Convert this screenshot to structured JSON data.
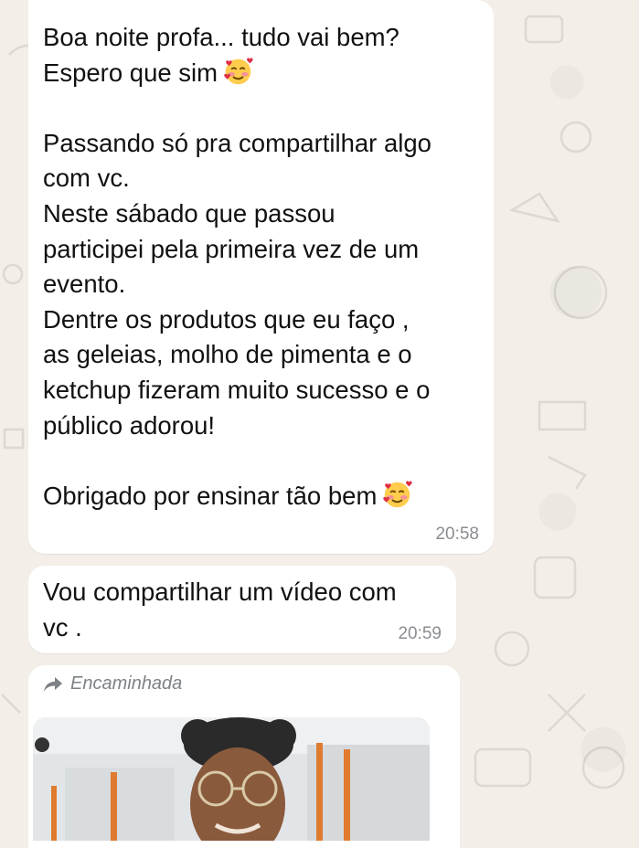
{
  "messages": [
    {
      "text_lines": [
        "Boa noite profa... tudo vai bem?",
        "Espero que sim",
        "",
        "Passando só pra compartilhar algo",
        "com vc.",
        "Neste sábado que passou",
        "participei pela primeira vez de um",
        "evento.",
        "Dentre os produtos que eu faço ,",
        "as geleias, molho de pimenta e o",
        "ketchup fizeram muito sucesso e o",
        "público adorou!",
        "",
        "Obrigado por ensinar tão bem"
      ],
      "time": "20:58",
      "emoji_icon": "smiling-face-with-hearts-icon"
    },
    {
      "text_lines": [
        "Vou compartilhar um vídeo com",
        "vc ."
      ],
      "time": "20:59"
    },
    {
      "forwarded_label": "Encaminhada",
      "forward_icon": "forward-arrow-icon",
      "media": "video-thumbnail"
    }
  ],
  "colors": {
    "chat_background": "#f3efe8",
    "bubble": "#ffffff",
    "text": "#111111",
    "timestamp": "#8a8d91",
    "forward_label": "#7d8286"
  }
}
